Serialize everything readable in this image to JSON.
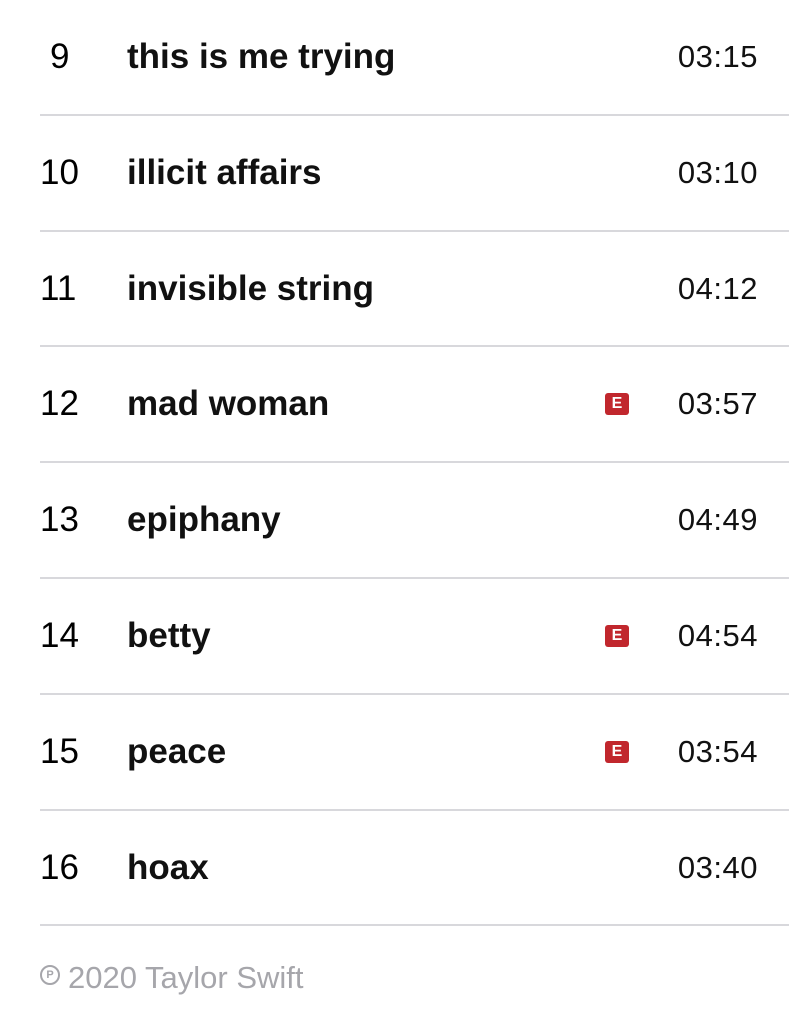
{
  "tracks": [
    {
      "number": "9",
      "title": "this is me trying",
      "explicit": false,
      "duration": "03:15"
    },
    {
      "number": "10",
      "title": "illicit affairs",
      "explicit": false,
      "duration": "03:10"
    },
    {
      "number": "11",
      "title": "invisible string",
      "explicit": false,
      "duration": "04:12"
    },
    {
      "number": "12",
      "title": "mad woman",
      "explicit": true,
      "duration": "03:57"
    },
    {
      "number": "13",
      "title": "epiphany",
      "explicit": false,
      "duration": "04:49"
    },
    {
      "number": "14",
      "title": "betty",
      "explicit": true,
      "duration": "04:54"
    },
    {
      "number": "15",
      "title": "peace",
      "explicit": true,
      "duration": "03:54"
    },
    {
      "number": "16",
      "title": "hoax",
      "explicit": false,
      "duration": "03:40"
    }
  ],
  "explicit_badge_label": "E",
  "colors": {
    "explicit_badge": "#c1272d",
    "divider": "#d8d8dc",
    "footer_text": "#a6a6ab"
  },
  "footer": {
    "phonogram_symbol": "P",
    "copyright_text": "2020 Taylor Swift"
  }
}
